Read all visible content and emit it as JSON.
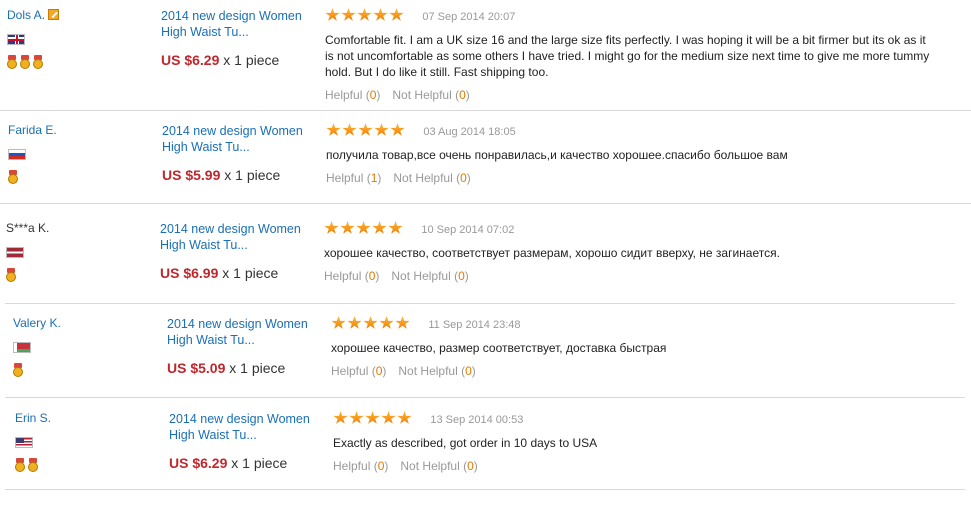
{
  "reviews": [
    {
      "user": "Dols A.",
      "flag": "gb",
      "medal_count": 3,
      "product_title_line1": "2014 new design Women",
      "product_title_line2": "High Waist Tu...",
      "price": "US $6.29",
      "quantity": "x 1 piece",
      "stars": 5,
      "date": "07 Sep 2014 20:07",
      "text_lines": [
        "Comfortable fit. I am a UK size 16 and the large size fits perfectly. I was hoping it will be a bit firmer but its ok as it",
        "is not uncomfortable as some others I have tried. I might go for the medium size next time to give me more tummy",
        "hold. But I do like it still. Fast shipping too."
      ],
      "helpful_label": "Helpful",
      "helpful_count": "0",
      "not_helpful_label": "Not Helpful",
      "not_helpful_count": "0"
    },
    {
      "user": "Farida E.",
      "flag": "ru",
      "medal_count": 1,
      "product_title_line1": "2014 new design Women",
      "product_title_line2": "High Waist Tu...",
      "price": "US $5.99",
      "quantity": "x 1 piece",
      "stars": 5,
      "date": "03 Aug 2014 18:05",
      "text_lines": [
        "получила товар,все очень понравилась,и качество хорошее.спасибо большое вам"
      ],
      "helpful_label": "Helpful",
      "helpful_count": "1",
      "not_helpful_label": "Not Helpful",
      "not_helpful_count": "0"
    },
    {
      "user": "S***a K.",
      "flag": "lv",
      "medal_count": 1,
      "product_title_line1": "2014 new design Women",
      "product_title_line2": "High Waist Tu...",
      "price": "US $6.99",
      "quantity": "x 1 piece",
      "stars": 5,
      "date": "10 Sep 2014 07:02",
      "text_lines": [
        "хорошее качество, соответствует размерам, хорошо сидит вверху, не загинается."
      ],
      "helpful_label": "Helpful",
      "helpful_count": "0",
      "not_helpful_label": "Not Helpful",
      "not_helpful_count": "0"
    },
    {
      "user": "Valery K.",
      "flag": "by",
      "medal_count": 1,
      "product_title_line1": "2014 new design Women",
      "product_title_line2": "High Waist Tu...",
      "price": "US $5.09",
      "quantity": "x 1 piece",
      "stars": 5,
      "date": "11 Sep 2014 23:48",
      "text_lines": [
        "хорошее качество, размер соответствует, доставка быстрая"
      ],
      "helpful_label": "Helpful",
      "helpful_count": "0",
      "not_helpful_label": "Not Helpful",
      "not_helpful_count": "0"
    },
    {
      "user": "Erin S.",
      "flag": "us",
      "medal_count": 2,
      "product_title_line1": "2014 new design Women",
      "product_title_line2": "High Waist Tu...",
      "price": "US $6.29",
      "quantity": "x 1 piece",
      "stars": 5,
      "date": "13 Sep 2014 00:53",
      "text_lines": [
        "Exactly as described, got order in 10 days to USA"
      ],
      "helpful_label": "Helpful",
      "helpful_count": "0",
      "not_helpful_label": "Not Helpful",
      "not_helpful_count": "0"
    }
  ],
  "colors": {
    "link": "#1a6fb5",
    "price": "#c0272d",
    "count": "#e07a00",
    "star": "#f5a000"
  },
  "icons": {
    "edit": "edit-icon",
    "medal": "medal-icon",
    "star": "star-icon"
  }
}
